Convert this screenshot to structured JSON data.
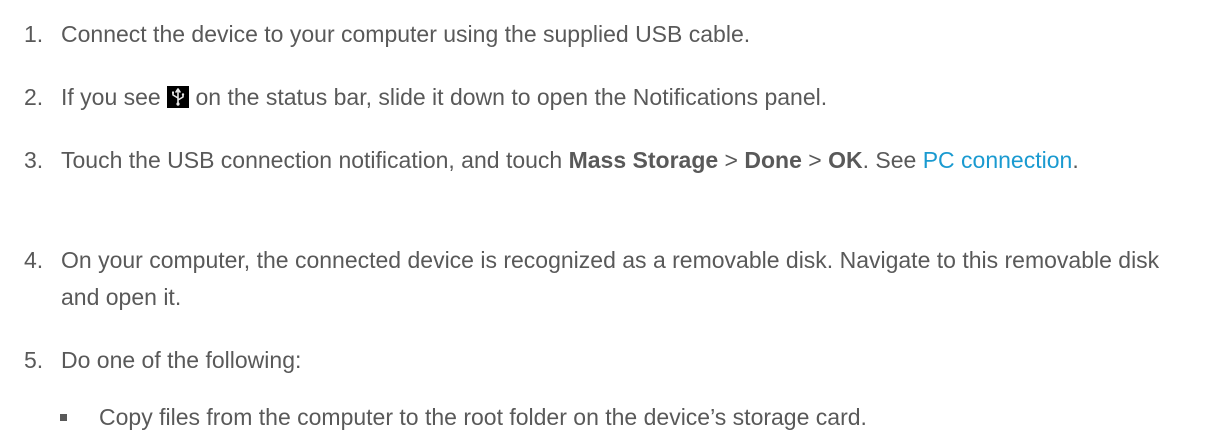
{
  "steps": [
    {
      "number": "1.",
      "text": "Connect the device to your computer using the supplied USB cable."
    },
    {
      "number": "2.",
      "text_before": "If you see",
      "icon": "usb-icon",
      "text_after": "on the status bar, slide it down to open the Notifications panel."
    },
    {
      "number": "3.",
      "text_a": "Touch the USB connection notification, and touch ",
      "bold_1": "Mass Storage",
      "sep_1": " > ",
      "bold_2": "Done",
      "sep_2": " > ",
      "bold_3": "OK",
      "text_b": ". See ",
      "link": "PC connection",
      "text_c": "."
    },
    {
      "number": "4.",
      "text": "On your computer, the connected device is recognized as a removable disk. Navigate to this removable disk and open it."
    },
    {
      "number": "5.",
      "text": "Do one of the following:"
    }
  ],
  "bullets": [
    "Copy files from the computer to the root folder on the device’s storage card."
  ],
  "colors": {
    "text": "#595959",
    "link": "#1a9ad0"
  }
}
